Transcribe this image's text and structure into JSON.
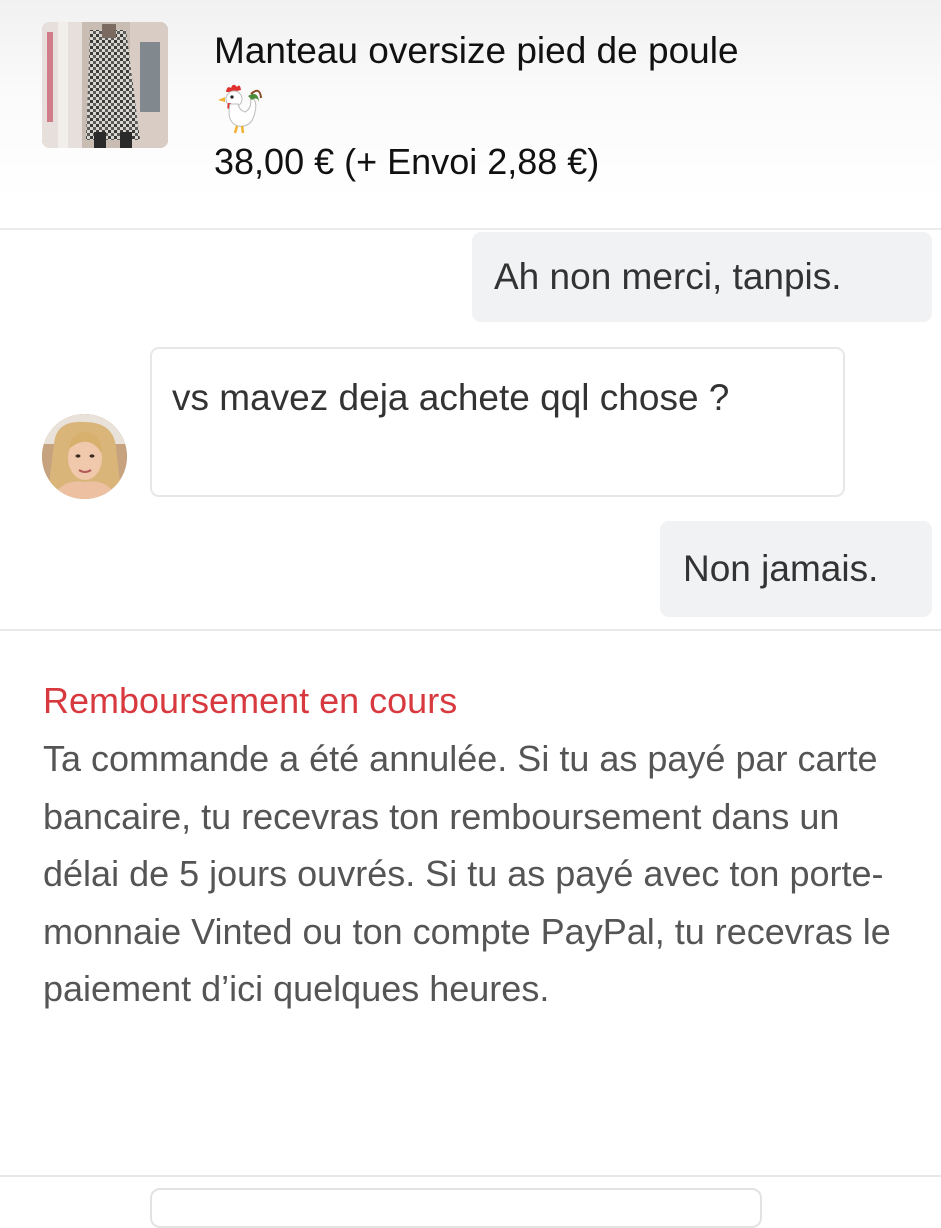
{
  "item": {
    "title": "Manteau oversize pied de poule",
    "emoji_icon": "rooster-icon",
    "price": "38,00 €",
    "shipping": "(+ Envoi 2,88 €)"
  },
  "messages": [
    {
      "direction": "out",
      "text": "Ah non merci, tanpis."
    },
    {
      "direction": "in",
      "text": "vs mavez deja achete qql chose ?"
    },
    {
      "direction": "out",
      "text": "Non jamais."
    }
  ],
  "status": {
    "title": "Remboursement en cours",
    "body": "Ta commande a été annulée. Si tu as payé par carte bancaire, tu recevras ton remboursement dans un délai de 5 jours ouvrés. Si tu as payé avec ton porte-monnaie Vinted ou ton compte PayPal, tu recevras le paiement d’ici quelques heures."
  },
  "colors": {
    "accent_red": "#d7393f",
    "outgoing_bubble": "#f1f2f4",
    "body_text": "#555555"
  }
}
